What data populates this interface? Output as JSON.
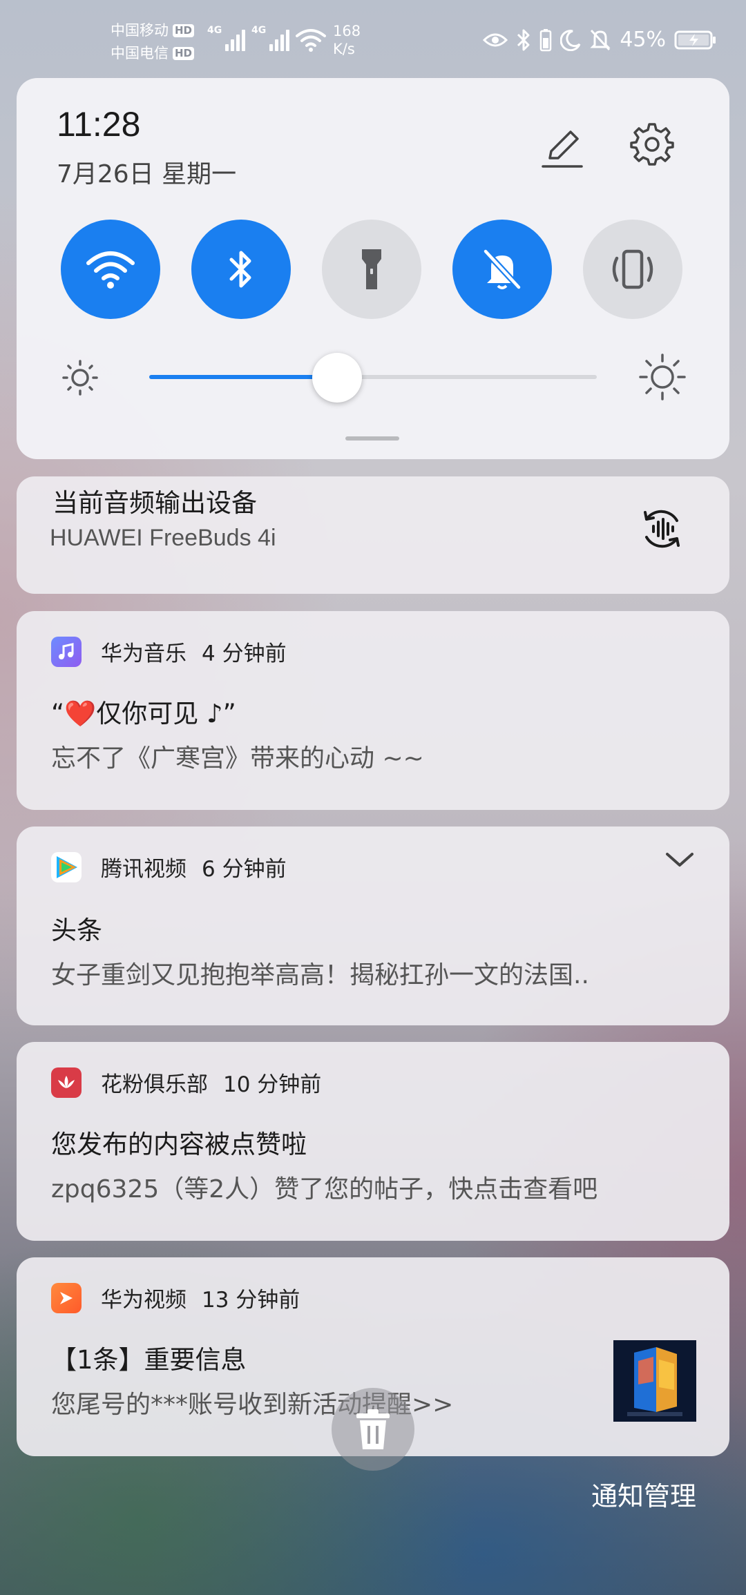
{
  "status_bar": {
    "carrier_1": "中国移动",
    "carrier_2": "中国电信",
    "hd_badge": "HD",
    "network_1": "4G",
    "network_2": "4G",
    "speed_value": "168",
    "speed_unit": "K/s",
    "battery_percent": "45%",
    "icons": [
      "eye-comfort-icon",
      "bluetooth-icon",
      "headset-battery-icon",
      "moon-icon",
      "mute-bell-icon",
      "battery-charging-icon"
    ]
  },
  "quick_settings": {
    "time": "11:28",
    "date": "7月26日 星期一",
    "toggles": [
      {
        "name": "wifi",
        "state": "on"
      },
      {
        "name": "bluetooth",
        "state": "on"
      },
      {
        "name": "flashlight",
        "state": "off"
      },
      {
        "name": "silent",
        "state": "on"
      },
      {
        "name": "vibrate",
        "state": "off"
      }
    ],
    "brightness_level": 0.42,
    "colors": {
      "accent": "#1a7ff0",
      "toggle_off": "#dcdde1"
    }
  },
  "audio_output": {
    "title": "当前音频输出设备",
    "device": "HUAWEI FreeBuds 4i"
  },
  "notifications": [
    {
      "app": "华为音乐",
      "time": "4 分钟前",
      "title": "“❤️仅你可见 ♪”",
      "body": "忘不了《广寒宫》带来的心动 ~~",
      "icon": "huawei-music-icon"
    },
    {
      "app": "腾讯视频",
      "time": "6 分钟前",
      "title": "头条",
      "body": "女子重剑又见抱抱举高高！揭秘扛孙一文的法国..",
      "icon": "tencent-video-icon"
    },
    {
      "app": "花粉俱乐部",
      "time": "10 分钟前",
      "title": "您发布的内容被点赞啦",
      "body": "zpq6325（等2人）赞了您的帖子，快点击查看吧",
      "icon": "huafen-club-icon"
    },
    {
      "app": "华为视频",
      "time": "13 分钟前",
      "title": "【1条】重要信息",
      "body": "您尾号的***账号收到新活动提醒>>",
      "icon": "huawei-video-icon"
    }
  ],
  "footer": {
    "manage_label": "通知管理"
  }
}
